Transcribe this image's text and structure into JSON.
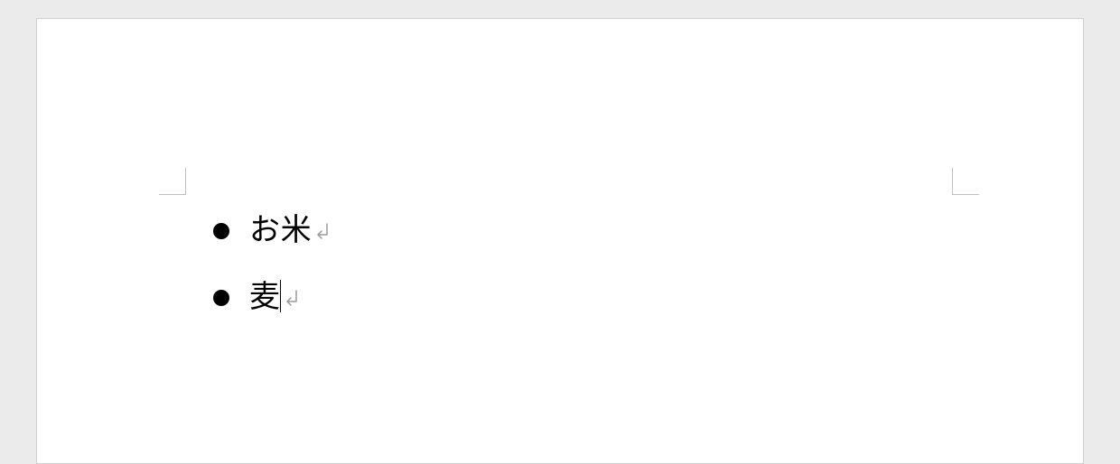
{
  "document": {
    "list": {
      "items": [
        {
          "text": "お米",
          "has_cursor": false
        },
        {
          "text": "麦",
          "has_cursor": true
        }
      ]
    }
  }
}
